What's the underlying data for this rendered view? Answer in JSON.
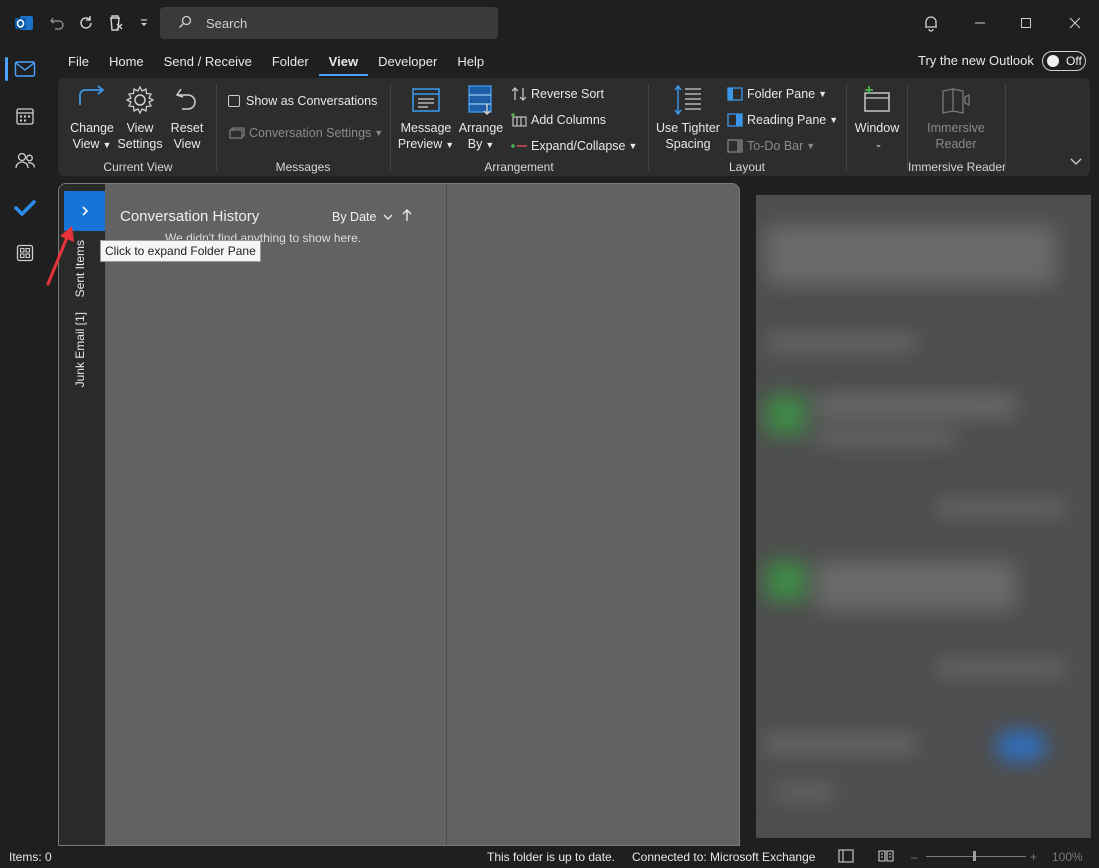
{
  "titlebar": {
    "search_placeholder": "Search"
  },
  "tabs": [
    {
      "label": "File"
    },
    {
      "label": "Home"
    },
    {
      "label": "Send / Receive"
    },
    {
      "label": "Folder"
    },
    {
      "label": "View",
      "active": true
    },
    {
      "label": "Developer"
    },
    {
      "label": "Help"
    }
  ],
  "try_new_outlook": {
    "label": "Try the new Outlook",
    "toggle_state": "Off"
  },
  "ribbon": {
    "current_view": {
      "label": "Current View",
      "change_view_1": "Change",
      "change_view_2": "View",
      "view_settings_1": "View",
      "view_settings_2": "Settings",
      "reset_view_1": "Reset",
      "reset_view_2": "View"
    },
    "messages": {
      "label": "Messages",
      "show_as_conversations": "Show as Conversations",
      "conversation_settings": "Conversation Settings"
    },
    "arrangement": {
      "label": "Arrangement",
      "message_preview_1": "Message",
      "message_preview_2": "Preview",
      "arrange_by_1": "Arrange",
      "arrange_by_2": "By",
      "reverse_sort": "Reverse Sort",
      "add_columns": "Add Columns",
      "expand_collapse": "Expand/Collapse"
    },
    "layout": {
      "label": "Layout",
      "use_tighter_1": "Use Tighter",
      "use_tighter_2": "Spacing",
      "folder_pane": "Folder Pane",
      "reading_pane": "Reading Pane",
      "todo_bar": "To-Do Bar"
    },
    "window": {
      "label": "Window"
    },
    "immersive_reader": {
      "label": "Immersive Reader",
      "btn_1": "Immersive",
      "btn_2": "Reader"
    }
  },
  "folder_strip": {
    "sent_items": "Sent Items",
    "junk_email": "Junk Email [1]"
  },
  "message_list": {
    "title": "Conversation History",
    "sort": "By Date",
    "empty_text": "We didn't find anything to show here."
  },
  "tooltip": "Click to expand Folder Pane",
  "statusbar": {
    "items": "Items: 0",
    "up_to_date": "This folder is up to date.",
    "connected": "Connected to: Microsoft Exchange",
    "zoom": "100%"
  },
  "colors": {
    "accent": "#1674d6",
    "annotation_arrow": "#e8333a"
  }
}
